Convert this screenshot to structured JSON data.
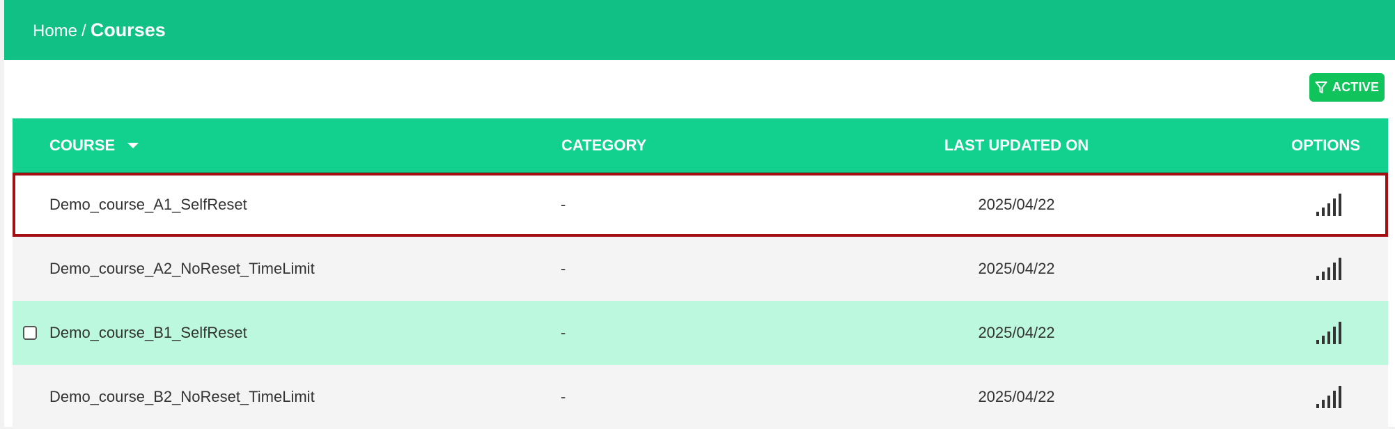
{
  "breadcrumb": {
    "home": "Home",
    "separator": "/",
    "current": "Courses"
  },
  "filter_button": {
    "label": "ACTIVE",
    "icon": "filter-icon",
    "color": "#10c35b"
  },
  "table": {
    "columns": {
      "course": "COURSE",
      "category": "CATEGORY",
      "last_updated": "LAST UPDATED ON",
      "options": "OPTIONS"
    },
    "sort_icon": "caret-down-icon",
    "rows": [
      {
        "name": "Demo_course_A1_SelfReset",
        "category": "-",
        "date": "2025/04/22",
        "options_icon": "signal-bars-icon"
      },
      {
        "name": "Demo_course_A2_NoReset_TimeLimit",
        "category": "-",
        "date": "2025/04/22",
        "options_icon": "signal-bars-icon"
      },
      {
        "name": "Demo_course_B1_SelfReset",
        "category": "-",
        "date": "2025/04/22",
        "options_icon": "signal-bars-icon"
      },
      {
        "name": "Demo_course_B2_NoReset_TimeLimit",
        "category": "-",
        "date": "2025/04/22",
        "options_icon": "signal-bars-icon"
      }
    ]
  },
  "colors": {
    "header_bar": "#10c084",
    "table_header": "#12d18e",
    "row_hover": "#bcf8dd",
    "highlight_outline": "#a30f12"
  }
}
